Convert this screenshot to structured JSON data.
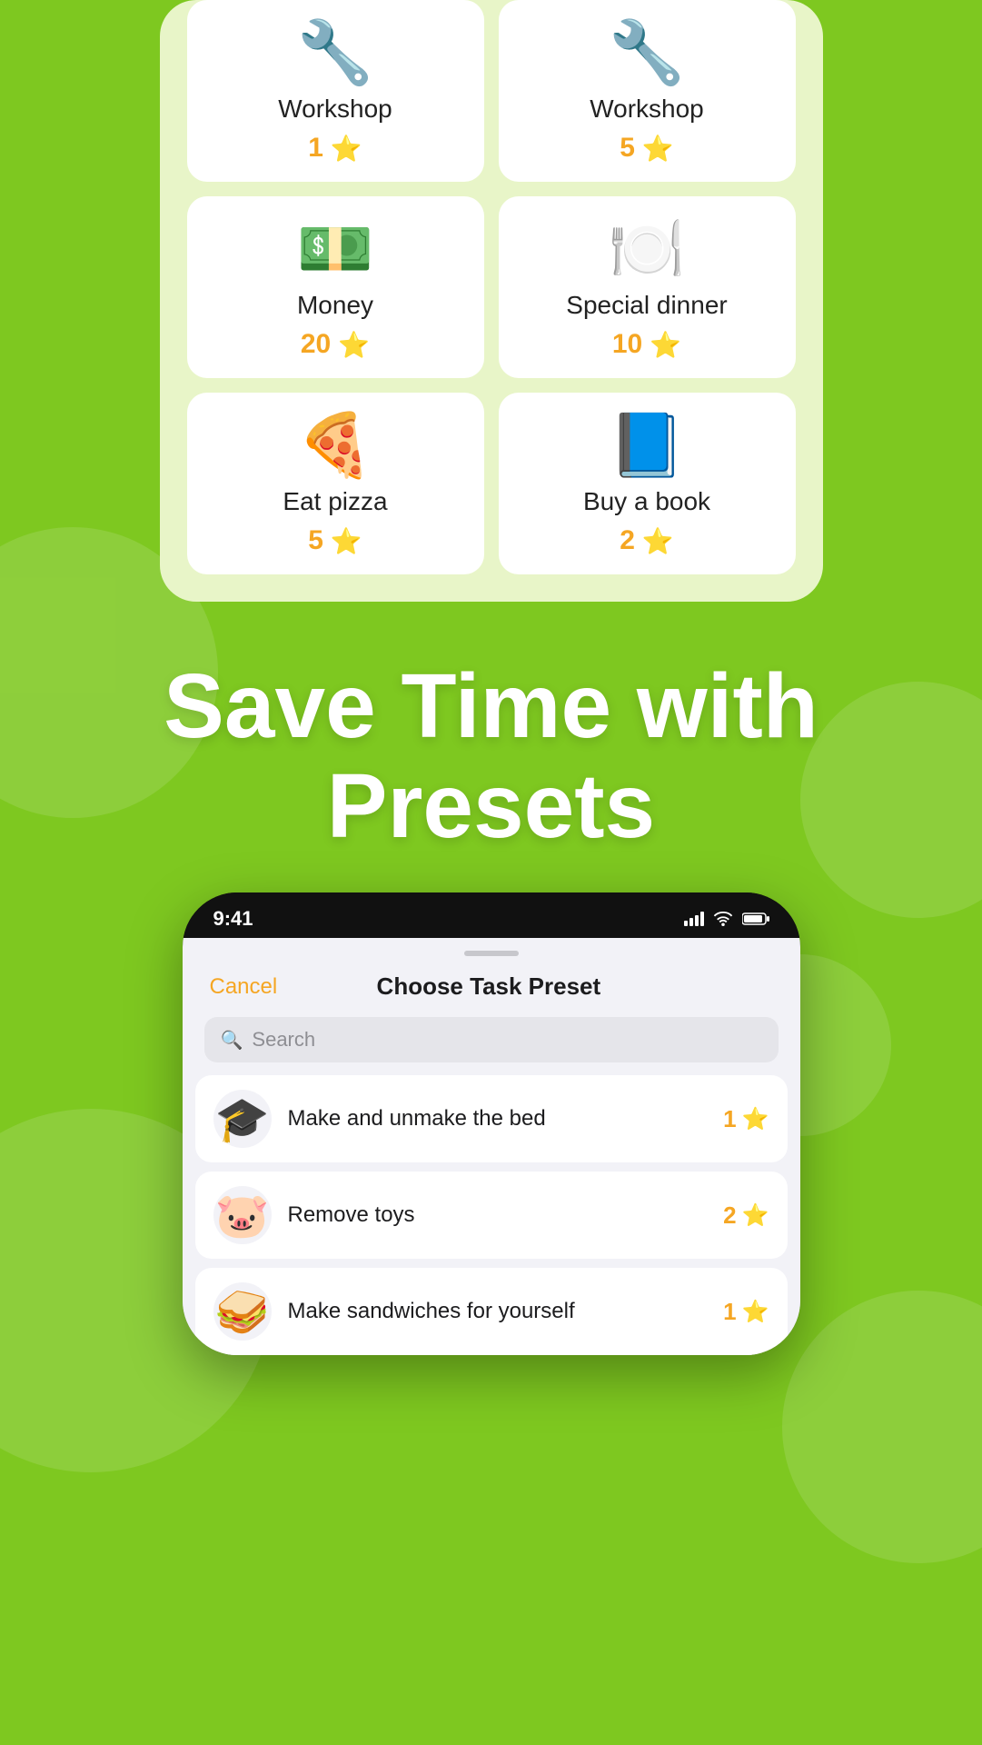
{
  "blobs": [
    1,
    2,
    3,
    4,
    5
  ],
  "top_card": {
    "rewards": [
      {
        "id": "workshop1",
        "icon": "🔧",
        "name": "Workshop",
        "points": "1"
      },
      {
        "id": "workshop5",
        "icon": "🔧",
        "name": "Workshop",
        "points": "5"
      },
      {
        "id": "money20",
        "icon": "💵",
        "name": "Money",
        "points": "20"
      },
      {
        "id": "special10",
        "icon": "🍽️",
        "name": "Special dinner",
        "points": "10"
      },
      {
        "id": "pizza5",
        "icon": "🍕",
        "name": "Eat pizza",
        "points": "5"
      },
      {
        "id": "book2",
        "icon": "📘",
        "name": "Buy a book",
        "points": "2"
      }
    ]
  },
  "headline": {
    "line1": "Save Time with",
    "line2": "Presets"
  },
  "phone": {
    "status": {
      "time": "9:41",
      "signal": "📶",
      "wifi": "wifi",
      "battery": "🔋"
    },
    "modal": {
      "cancel_label": "Cancel",
      "title": "Choose Task Preset",
      "search_placeholder": "Search",
      "tasks": [
        {
          "id": "bed",
          "emoji": "🎓",
          "label": "Make and unmake the bed",
          "points": "1"
        },
        {
          "id": "toys",
          "emoji": "🐷",
          "label": "Remove toys",
          "points": "2"
        },
        {
          "id": "sandwiches",
          "emoji": "🥪",
          "label": "Make sandwiches for yourself",
          "points": "1"
        }
      ]
    }
  }
}
